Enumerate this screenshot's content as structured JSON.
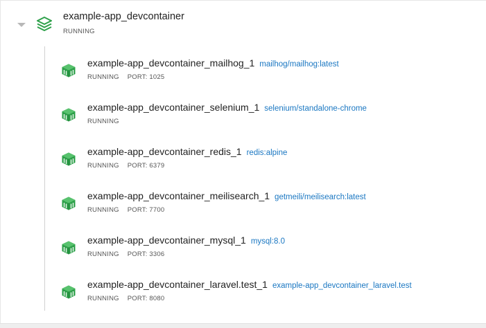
{
  "group": {
    "name": "example-app_devcontainer",
    "status": "RUNNING",
    "accent": "#2ea04a"
  },
  "containers": [
    {
      "name": "example-app_devcontainer_mailhog_1",
      "image": "mailhog/mailhog:latest",
      "status": "RUNNING",
      "port": "PORT: 1025"
    },
    {
      "name": "example-app_devcontainer_selenium_1",
      "image": "selenium/standalone-chrome",
      "status": "RUNNING",
      "port": ""
    },
    {
      "name": "example-app_devcontainer_redis_1",
      "image": "redis:alpine",
      "status": "RUNNING",
      "port": "PORT: 6379"
    },
    {
      "name": "example-app_devcontainer_meilisearch_1",
      "image": "getmeili/meilisearch:latest",
      "status": "RUNNING",
      "port": "PORT: 7700"
    },
    {
      "name": "example-app_devcontainer_mysql_1",
      "image": "mysql:8.0",
      "status": "RUNNING",
      "port": "PORT: 3306"
    },
    {
      "name": "example-app_devcontainer_laravel.test_1",
      "image": "example-app_devcontainer_laravel.test",
      "status": "RUNNING",
      "port": "PORT: 8080"
    }
  ],
  "icons": {
    "caret": "caret-down-icon",
    "group": "stack-icon",
    "container": "container-cube-icon"
  }
}
